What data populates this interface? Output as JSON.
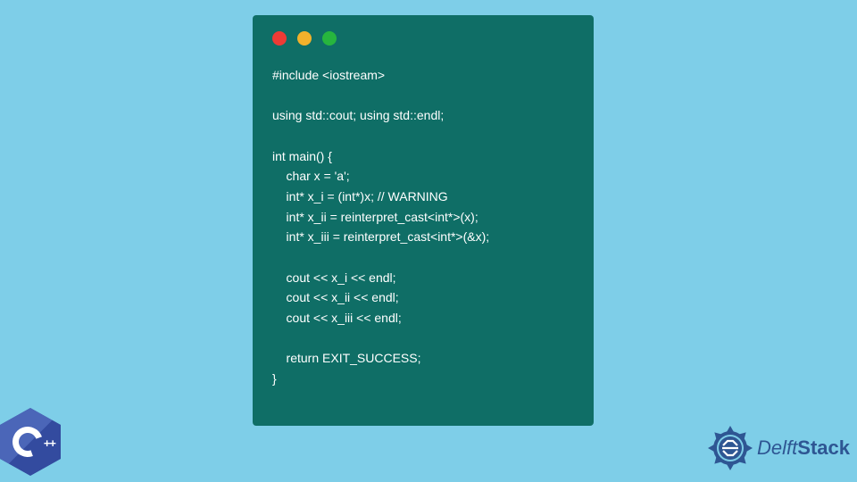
{
  "code": {
    "lines": [
      "#include <iostream>",
      "",
      "using std::cout; using std::endl;",
      "",
      "int main() {",
      "    char x = 'a';",
      "    int* x_i = (int*)x; // WARNING",
      "    int* x_ii = reinterpret_cast<int*>(x);",
      "    int* x_iii = reinterpret_cast<int*>(&x);",
      "",
      "    cout << x_i << endl;",
      "    cout << x_ii << endl;",
      "    cout << x_iii << endl;",
      "",
      "    return EXIT_SUCCESS;",
      "}"
    ]
  },
  "window": {
    "traffic_colors": {
      "red": "#ed3b35",
      "yellow": "#f2b12b",
      "green": "#27b53e"
    },
    "bg": "#0f6e66"
  },
  "page_bg": "#7ecee8",
  "cpp_logo": {
    "label": "C++"
  },
  "brand": {
    "name_a": "Delft",
    "name_b": "Stack"
  }
}
